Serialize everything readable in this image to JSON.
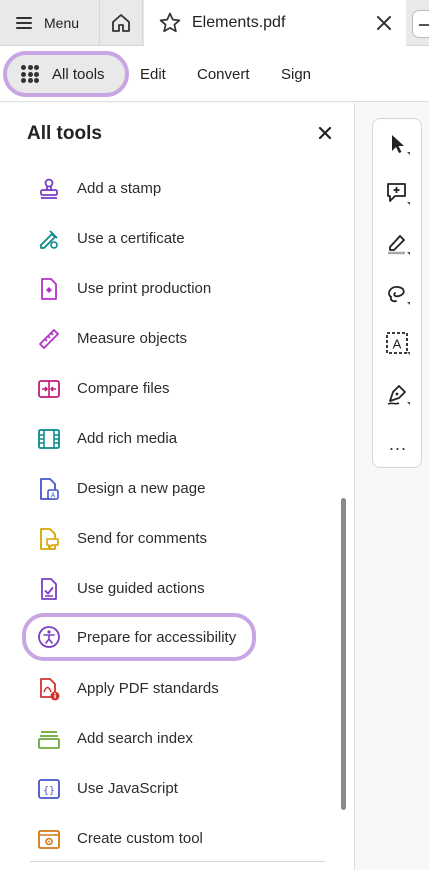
{
  "tabbar": {
    "menu_label": "Menu",
    "document_title": "Elements.pdf"
  },
  "toolbar": {
    "all_tools_label": "All tools",
    "links": [
      "Edit",
      "Convert",
      "Sign"
    ]
  },
  "panel": {
    "title": "All tools",
    "items": [
      {
        "label": "Add a stamp",
        "icon": "stamp-icon",
        "color": "#7a3fc4"
      },
      {
        "label": "Use a certificate",
        "icon": "certificate-pen-icon",
        "color": "#0b8a8a"
      },
      {
        "label": "Use print production",
        "icon": "print-production-icon",
        "color": "#b233c6"
      },
      {
        "label": "Measure objects",
        "icon": "ruler-icon",
        "color": "#b233c6"
      },
      {
        "label": "Compare files",
        "icon": "compare-files-icon",
        "color": "#c21a79"
      },
      {
        "label": "Add rich media",
        "icon": "film-strip-icon",
        "color": "#0b8a8a"
      },
      {
        "label": "Design a new page",
        "icon": "design-page-icon",
        "color": "#4456c9"
      },
      {
        "label": "Send for comments",
        "icon": "send-comments-icon",
        "color": "#d6a400"
      },
      {
        "label": "Use guided actions",
        "icon": "guided-actions-icon",
        "color": "#7a3fc4"
      },
      {
        "label": "Prepare for accessibility",
        "icon": "accessibility-icon",
        "color": "#7a3fc4",
        "highlighted": true
      },
      {
        "label": "Apply PDF standards",
        "icon": "pdf-standards-icon",
        "color": "#d0322c"
      },
      {
        "label": "Add search index",
        "icon": "search-index-icon",
        "color": "#6aaa3a"
      },
      {
        "label": "Use JavaScript",
        "icon": "javascript-icon",
        "color": "#4456c9"
      },
      {
        "label": "Create custom tool",
        "icon": "custom-tool-icon",
        "color": "#d47a12"
      }
    ]
  },
  "rail": {
    "tools": [
      "select-cursor-icon",
      "add-comment-icon",
      "highlight-pen-icon",
      "lasso-draw-icon",
      "text-select-icon",
      "fill-sign-icon",
      "more-options-icon"
    ],
    "more_glyph": "..."
  },
  "colors": {
    "highlight_ring": "#c8a6e3",
    "tab_bar_bg": "#e9e9e9"
  }
}
